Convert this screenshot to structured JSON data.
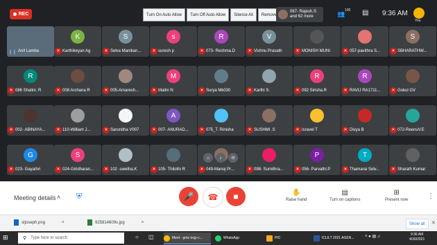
{
  "top_bar": {
    "rec_label": "REC",
    "host_controls": [
      "Turn On Auto Allow",
      "Turn Off Auto Allow",
      "Silence All",
      "Remove All"
    ],
    "participant_chip": {
      "line1": "067- Rajesh.S",
      "line2": "and 62 more"
    },
    "participant_count": "100",
    "time": "9:36 AM",
    "you_label": "You"
  },
  "colors": {
    "accent": "#1a73e8",
    "mute_red": "#c5221f",
    "end_call_red": "#ea4335",
    "tile_bg": "#3c4043",
    "app_bg": "#202124"
  },
  "tiles": [
    {
      "name": "Anil Lamba",
      "video": true,
      "muted": false
    },
    {
      "name": "Karthikeyan Ag",
      "letter": "K",
      "color": "#7cb342"
    },
    {
      "name": "Selva Manikan...",
      "letter": "S",
      "color": "#78909c"
    },
    {
      "name": "suresh p",
      "letter": "s",
      "color": "#ec407a"
    },
    {
      "name": "073- Reshma.D",
      "letter": "R",
      "color": "#ab47bc"
    },
    {
      "name": "Vishnu Prasath",
      "letter": "V",
      "color": "#78909c"
    },
    {
      "name": "MONISH MUNI",
      "photo": "#555555"
    },
    {
      "name": "057-pavithra S...",
      "photo": "#e57373"
    },
    {
      "name": "SBHARATHW...",
      "letter": "S",
      "color": "#8d6e63"
    },
    {
      "name": "086 Shalini. R",
      "letter": "R",
      "color": "#00897b"
    },
    {
      "name": "008 Archana R",
      "photo": "#6d4c41"
    },
    {
      "name": "005-Amaresh...",
      "photo": "#a1887f"
    },
    {
      "name": "Malini N",
      "letter": "M",
      "color": "#ec407a"
    },
    {
      "name": "Surya Mk030",
      "photo": "#607d8b"
    },
    {
      "name": "Karthi S.",
      "photo": "#90a4ae"
    },
    {
      "name": "092 Sirisha.R",
      "letter": "R",
      "color": "#ec407a"
    },
    {
      "name": "RAVIJ RA1711...",
      "letter": "R",
      "color": "#ab47bc"
    },
    {
      "name": "Gokul GV",
      "photo": "#795548"
    },
    {
      "name": "002- ABINAYA...",
      "photo": "#4e342e"
    },
    {
      "name": "110-William J...",
      "photo": "#9e9e9e"
    },
    {
      "name": "Sarunitha V007",
      "photo": "#f5f5f5"
    },
    {
      "name": "007- ANURAD...",
      "letter": "A",
      "color": "#7e57c2"
    },
    {
      "name": "075_T. Rinisha",
      "photo": "#4fc3f7"
    },
    {
      "name": "SUSHMI .S",
      "photo": "#8d6e63"
    },
    {
      "name": "Isravel T",
      "photo": "#fbc02d"
    },
    {
      "name": "Divya B",
      "photo": "#c62828"
    },
    {
      "name": "072-ReenuV.E",
      "photo": "#26a69a"
    },
    {
      "name": "023- Gayathri",
      "letter": "G",
      "color": "#1e88e5"
    },
    {
      "name": "024-Giridharan...",
      "letter": "S",
      "color": "#ec407a"
    },
    {
      "name": "102 -swetha.K",
      "photo": "#b0bec5"
    },
    {
      "name": "105- Thilothi R",
      "photo": "#546e7a"
    },
    {
      "name": "049-Manoj Pr...",
      "photo": "#8d6e63",
      "hover": true
    },
    {
      "name": "098- Sumithra...",
      "photo": "#e91e63"
    },
    {
      "name": "056- Parvathi.P",
      "letter": "P",
      "color": "#7b1fa2"
    },
    {
      "name": "Thamarai Selv...",
      "letter": "T",
      "color": "#00acc1"
    },
    {
      "name": "Sharath Kumar",
      "photo": "#616161"
    }
  ],
  "controls": {
    "meeting_details": "Meeting details",
    "raise_hand": "Raise hand",
    "captions": "Turn on captions",
    "present": "Present now"
  },
  "downloads": {
    "items": [
      "stjoseph.png",
      "925814609s.jpg"
    ],
    "show_all": "Show all"
  },
  "taskbar": {
    "search_placeholder": "Type here to search",
    "tasks": [
      "Meet - gmz-ocjy-c...",
      "WhatsApp",
      "PIC",
      "ICLILT 2021 AGEN..."
    ],
    "tray_time": "9:36 AM",
    "tray_date": "4/30/2021"
  }
}
